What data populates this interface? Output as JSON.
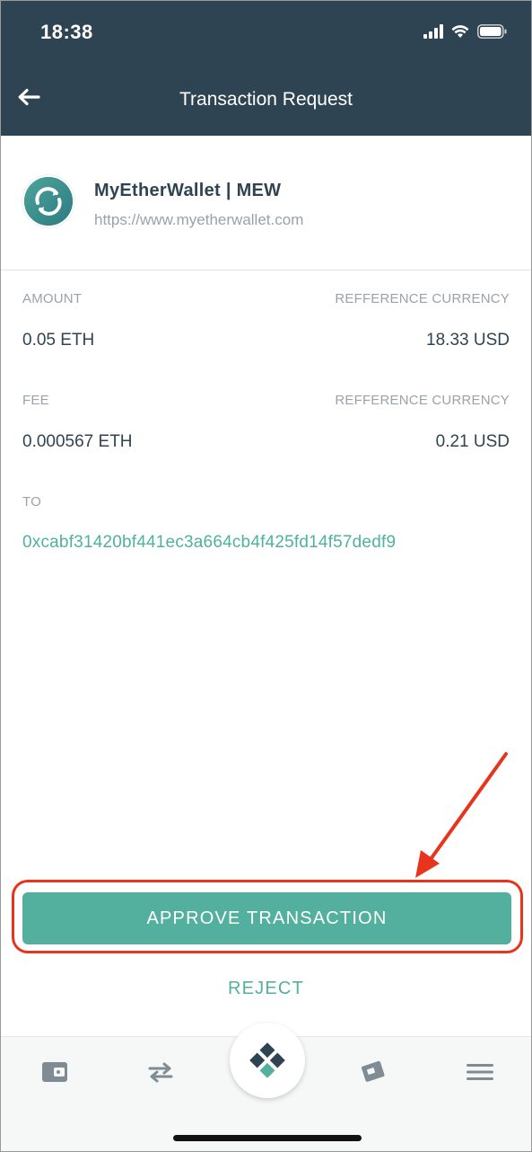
{
  "status_bar": {
    "time": "18:38"
  },
  "header": {
    "title": "Transaction Request",
    "back_icon": "arrow-left-icon"
  },
  "dapp": {
    "name": "MyEtherWallet | MEW",
    "url": "https://www.myetherwallet.com",
    "logo_icon": "mew-logo-icon"
  },
  "details": {
    "amount_label": "AMOUNT",
    "amount_value": "0.05 ETH",
    "amount_ref_label": "REFFERENCE CURRENCY",
    "amount_ref_value": "18.33 USD",
    "fee_label": "FEE",
    "fee_value": "0.000567 ETH",
    "fee_ref_label": "REFFERENCE CURRENCY",
    "fee_ref_value": "0.21 USD",
    "to_label": "TO",
    "to_address": "0xcabf31420bf441ec3a664cb4f425fd14f57dedf9"
  },
  "actions": {
    "approve_label": "APPROVE TRANSACTION",
    "reject_label": "REJECT"
  },
  "bottom_nav": {
    "items": [
      "wallet-icon",
      "exchange-arrows-icon",
      "app-logo-icon",
      "cards-icon",
      "menu-icon"
    ]
  },
  "colors": {
    "header_bg": "#2f4452",
    "accent": "#54b09e",
    "annotation": "#e8341c",
    "text_primary": "#2f4452",
    "text_muted": "#9aa3a9"
  }
}
